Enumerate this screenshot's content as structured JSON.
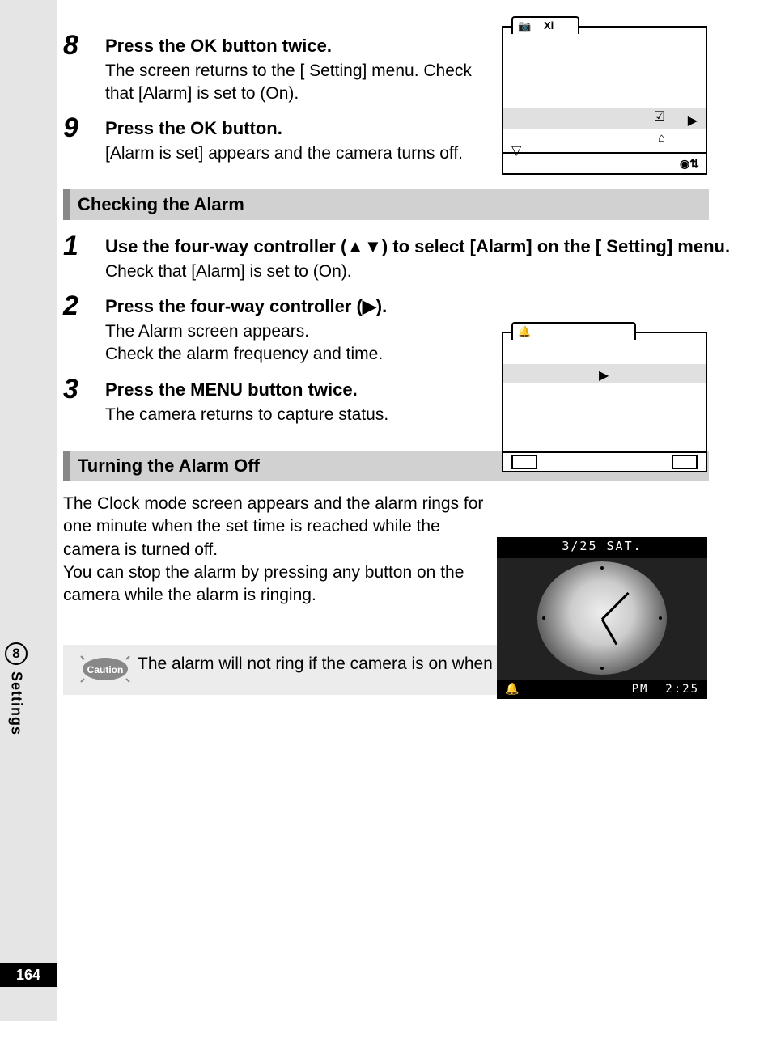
{
  "steps_a": [
    {
      "num": "8",
      "title_before": "Press the ",
      "title_strong": "OK",
      "title_after": " button twice.",
      "desc": "The screen returns to the [        Setting] menu. Check that [Alarm] is set to      (On)."
    },
    {
      "num": "9",
      "title_before": "Press the ",
      "title_strong": "OK",
      "title_after": " button.",
      "desc": "[Alarm is set] appears and the camera turns off."
    }
  ],
  "heading_check": "Checking the Alarm",
  "steps_b": [
    {
      "num": "1",
      "title": "Use the four-way controller (▲▼) to select [Alarm] on the [      Setting] menu.",
      "desc": "Check that [Alarm] is set to      (On)."
    },
    {
      "num": "2",
      "title": "Press the four-way controller (▶).",
      "desc": "The Alarm screen appears.\nCheck the alarm frequency and time."
    },
    {
      "num": "3",
      "title_before": "Press the ",
      "title_strong": "MENU",
      "title_after": " button twice.",
      "desc": "The camera returns to capture status."
    }
  ],
  "heading_off": "Turning the Alarm Off",
  "off_para": "The Clock mode screen appears and the alarm rings for one minute when the set time is reached while the camera is turned off.\nYou can stop the alarm by pressing any button on the camera while the alarm is ringing.",
  "caution_label": "Caution",
  "caution_text": "The alarm will not ring if the camera is on when the set time is reached.",
  "side_number": "8",
  "side_label": "Settings",
  "page_number": "164",
  "clock": {
    "date": "3/25 SAT.",
    "ampm": "PM",
    "time": "2:25"
  }
}
